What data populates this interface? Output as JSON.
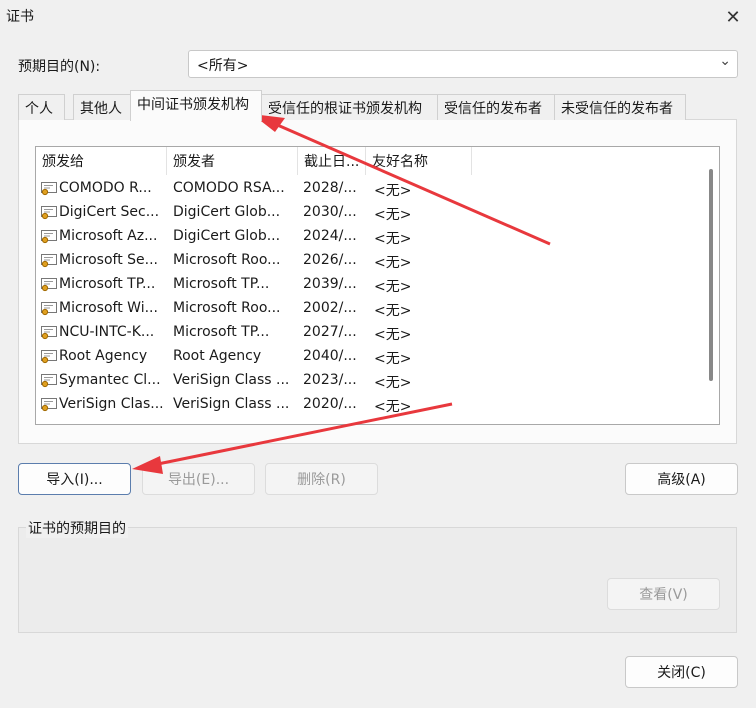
{
  "window": {
    "title": "证书"
  },
  "purpose": {
    "label": "预期目的(N):",
    "value": "<所有>"
  },
  "tabs": [
    {
      "label": "个人"
    },
    {
      "label": "其他人"
    },
    {
      "label": "中间证书颁发机构"
    },
    {
      "label": "受信任的根证书颁发机构"
    },
    {
      "label": "受信任的发布者"
    },
    {
      "label": "未受信任的发布者"
    }
  ],
  "active_tab_index": 2,
  "list": {
    "columns": [
      "颁发给",
      "颁发者",
      "截止日...",
      "友好名称"
    ],
    "rows": [
      {
        "issued_to": "COMODO R...",
        "issued_by": "COMODO RSA...",
        "expires": "2028/...",
        "friendly": "<无>"
      },
      {
        "issued_to": "DigiCert Sec...",
        "issued_by": "DigiCert Glob...",
        "expires": "2030/...",
        "friendly": "<无>"
      },
      {
        "issued_to": "Microsoft Az...",
        "issued_by": "DigiCert Glob...",
        "expires": "2024/...",
        "friendly": "<无>"
      },
      {
        "issued_to": "Microsoft Se...",
        "issued_by": "Microsoft Roo...",
        "expires": "2026/...",
        "friendly": "<无>"
      },
      {
        "issued_to": "Microsoft TP...",
        "issued_by": "Microsoft TP...",
        "expires": "2039/...",
        "friendly": "<无>"
      },
      {
        "issued_to": "Microsoft Wi...",
        "issued_by": "Microsoft Roo...",
        "expires": "2002/...",
        "friendly": "<无>"
      },
      {
        "issued_to": "NCU-INTC-K...",
        "issued_by": "Microsoft TP...",
        "expires": "2027/...",
        "friendly": "<无>"
      },
      {
        "issued_to": "Root Agency",
        "issued_by": "Root Agency",
        "expires": "2040/...",
        "friendly": "<无>"
      },
      {
        "issued_to": "Symantec Cl...",
        "issued_by": "VeriSign Class ...",
        "expires": "2023/...",
        "friendly": "<无>"
      },
      {
        "issued_to": "VeriSign Clas...",
        "issued_by": "VeriSign Class ...",
        "expires": "2020/...",
        "friendly": "<无>"
      }
    ]
  },
  "buttons": {
    "import": "导入(I)...",
    "export": "导出(E)...",
    "remove": "删除(R)",
    "advanced": "高级(A)",
    "view": "查看(V)",
    "close": "关闭(C)"
  },
  "purposes_group": {
    "label": "证书的预期目的"
  },
  "icons": {
    "close": "close-icon",
    "chevron": "chevron-down-icon",
    "cert": "certificate-icon"
  },
  "colors": {
    "annotation_arrow": "#e8383d",
    "selected_border": "#5b7dad"
  }
}
